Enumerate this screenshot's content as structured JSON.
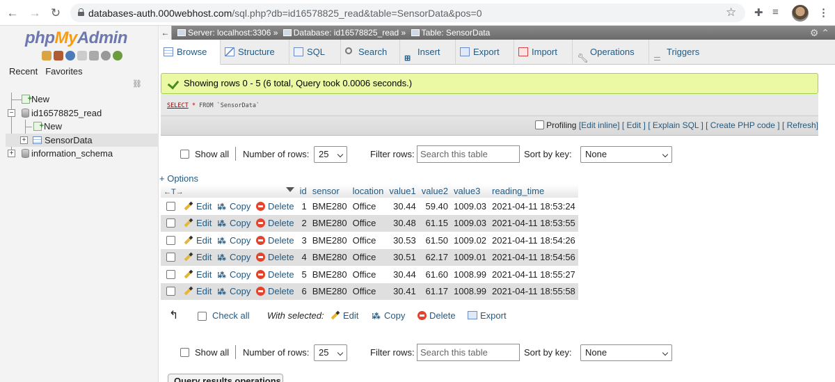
{
  "browser": {
    "url_host": "databases-auth.000webhost.com",
    "url_path": "/sql.php?db=id16578825_read&table=SensorData&pos=0"
  },
  "sidebar": {
    "logo_php": "php",
    "logo_my": "My",
    "logo_admin": "Admin",
    "tabs": [
      "Recent",
      "Favorites"
    ],
    "tree": [
      {
        "label": "New"
      },
      {
        "label": "id16578825_read"
      },
      {
        "label": "New"
      },
      {
        "label": "SensorData"
      },
      {
        "label": "information_schema"
      }
    ]
  },
  "breadcrumb": {
    "server": "Server: localhost:3306 »",
    "database": "Database: id16578825_read »",
    "table": "Table: SensorData"
  },
  "tabs": [
    "Browse",
    "Structure",
    "SQL",
    "Search",
    "Insert",
    "Export",
    "Import",
    "Operations",
    "Triggers"
  ],
  "message": {
    "success": "Showing rows 0 - 5 (6 total, Query took 0.0006 seconds.)",
    "sql_select": "SELECT",
    "sql_star": "*",
    "sql_rest": "FROM `SensorData`"
  },
  "profiling": {
    "label": "Profiling",
    "links": "[Edit inline] [ Edit ] [ Explain SQL ] [ Create PHP code ] [ Refresh]"
  },
  "nav": {
    "show_all": "Show all",
    "number_of_rows": "Number of rows:",
    "rows_value": "25",
    "filter_rows": "Filter rows:",
    "search_placeholder": "Search this table",
    "sort_by_key": "Sort by key:",
    "sort_value": "None"
  },
  "options_link": "+ Options",
  "arrows_glyph": "←T→",
  "table": {
    "columns": [
      "id",
      "sensor",
      "location",
      "value1",
      "value2",
      "value3",
      "reading_time"
    ],
    "row_actions": {
      "edit": "Edit",
      "copy": "Copy",
      "delete": "Delete"
    },
    "rows": [
      [
        "1",
        "BME280",
        "Office",
        "30.44",
        "59.40",
        "1009.03",
        "2021-04-11 18:53:24"
      ],
      [
        "2",
        "BME280",
        "Office",
        "30.48",
        "61.15",
        "1009.03",
        "2021-04-11 18:53:55"
      ],
      [
        "3",
        "BME280",
        "Office",
        "30.53",
        "61.50",
        "1009.02",
        "2021-04-11 18:54:26"
      ],
      [
        "4",
        "BME280",
        "Office",
        "30.51",
        "62.17",
        "1009.01",
        "2021-04-11 18:54:56"
      ],
      [
        "5",
        "BME280",
        "Office",
        "30.44",
        "61.60",
        "1008.99",
        "2021-04-11 18:55:27"
      ],
      [
        "6",
        "BME280",
        "Office",
        "30.41",
        "61.17",
        "1008.99",
        "2021-04-11 18:55:58"
      ]
    ]
  },
  "bulk": {
    "check_all": "Check all",
    "with_selected": "With selected:",
    "edit": "Edit",
    "copy": "Copy",
    "delete": "Delete",
    "export": "Export"
  },
  "query_ops": "Query results operations",
  "colors": {
    "accent": "#235a81",
    "success_bg": "#ebf8a4",
    "row_alt": "#dfdfdf"
  }
}
